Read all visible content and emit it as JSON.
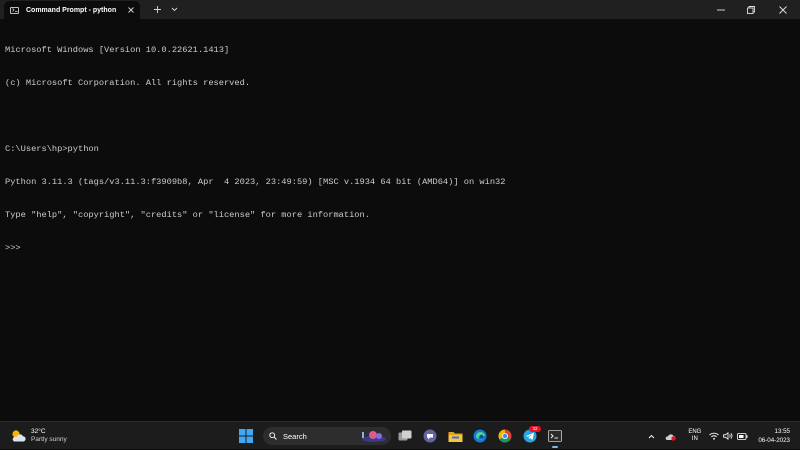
{
  "window": {
    "tab_title": "Command Prompt - python",
    "icons": {
      "tab": "terminal-icon",
      "close_tab": "close-icon",
      "new_tab": "plus-icon",
      "dropdown": "chevron-down-icon",
      "minimize": "minimize-icon",
      "maximize": "restore-icon",
      "close": "close-icon"
    }
  },
  "terminal": {
    "lines": [
      "Microsoft Windows [Version 10.0.22621.1413]",
      "(c) Microsoft Corporation. All rights reserved.",
      "",
      "C:\\Users\\hp>python",
      "Python 3.11.3 (tags/v3.11.3:f3909b8, Apr  4 2023, 23:49:59) [MSC v.1934 64 bit (AMD64)] on win32",
      "Type \"help\", \"copyright\", \"credits\" or \"license\" for more information.",
      ">>>"
    ]
  },
  "taskbar": {
    "weather": {
      "temp": "32°C",
      "desc": "Partly sunny",
      "icon": "partly-sunny-icon"
    },
    "search_label": "Search",
    "badge_count": "32",
    "apps": [
      "windows-start-icon",
      "task-view-icon",
      "teams-chat-icon",
      "file-explorer-icon",
      "edge-icon",
      "chrome-icon",
      "telegram-icon",
      "terminal-icon"
    ],
    "tray": {
      "lang_line1": "ENG",
      "lang_line2": "IN",
      "time": "13:55",
      "date": "06-04-2023"
    }
  },
  "colors": {
    "terminal_bg": "#0c0c0c",
    "terminal_fg": "#cccccc",
    "titlebar_bg": "#202020",
    "taskbar_bg": "#1c1c1c",
    "accent": "#76b9ed"
  }
}
